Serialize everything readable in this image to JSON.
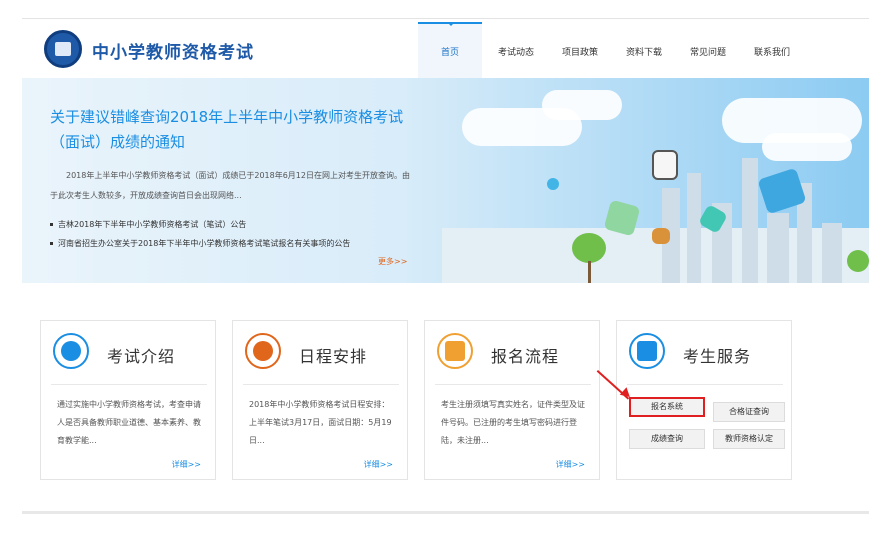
{
  "header": {
    "site_title": "中小学教师资格考试",
    "nav": [
      {
        "label": "首页",
        "active": true
      },
      {
        "label": "考试动态",
        "active": false
      },
      {
        "label": "项目政策",
        "active": false
      },
      {
        "label": "资料下载",
        "active": false
      },
      {
        "label": "常见问题",
        "active": false
      },
      {
        "label": "联系我们",
        "active": false
      }
    ]
  },
  "banner": {
    "headline": "关于建议错峰查询2018年上半年中小学教师资格考试（面试）成绩的通知",
    "summary": "2018年上半年中小学教师资格考试（面试）成绩已于2018年6月12日在网上对考生开放查询。由于此次考生人数较多，开放成绩查询首日会出现网络...",
    "news": [
      "吉林2018年下半年中小学教师资格考试（笔试）公告",
      "河南省招生办公室关于2018年下半年中小学教师资格考试笔试报名有关事项的公告"
    ],
    "more": "更多>>"
  },
  "cards": [
    {
      "title": "考试介绍",
      "icon": "edit-document-icon",
      "desc": "通过实施中小学教师资格考试，考查申请人是否具备教师职业道德、基本素养、教育教学能...",
      "more": "详细>>"
    },
    {
      "title": "日程安排",
      "icon": "check-mark-icon",
      "desc": "2018年中小学教师资格考试日程安排：上半年笔试3月17日，面试日期：5月19日...",
      "more": "详细>>"
    },
    {
      "title": "报名流程",
      "icon": "form-icon",
      "desc": "考生注册须填写真实姓名，证件类型及证件号码。已注册的考生填写密码进行登陆，未注册...",
      "more": "详细>>"
    },
    {
      "title": "考生服务",
      "icon": "id-card-icon"
    }
  ],
  "services": {
    "register": "报名系统",
    "certificate": "合格证查询",
    "scores": "成绩查询",
    "qualification": "教师资格认定"
  },
  "colors": {
    "brand": "#1f5aa8",
    "accent": "#1a8ee2",
    "highlight": "#e02020",
    "more": "#e0661c"
  }
}
